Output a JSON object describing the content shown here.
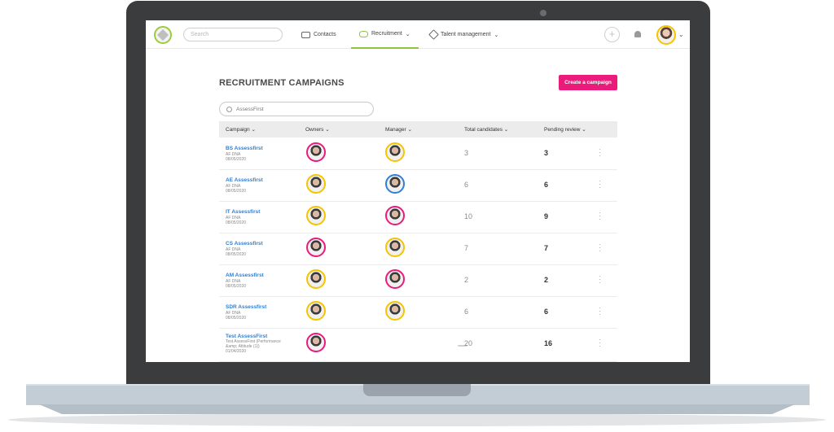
{
  "topbar": {
    "search_placeholder": "Search",
    "nav": [
      {
        "label": "Contacts",
        "icon": "contacts-icon",
        "active": false
      },
      {
        "label": "Recruitment",
        "icon": "recruitment-icon",
        "active": true
      },
      {
        "label": "Talent management",
        "icon": "diamond-icon",
        "active": false
      }
    ],
    "accent_color": "#8cc63f"
  },
  "page": {
    "title": "RECRUITMENT CAMPAIGNS",
    "create_button": "Create a campaign",
    "filter_value": "AssessFirst",
    "brand_color": "#ea1b7b"
  },
  "table": {
    "headers": [
      "Campaign",
      "Owners",
      "Manager",
      "Total candidates",
      "Pending review"
    ],
    "rows": [
      {
        "name": "BS Assessfirst",
        "sub": "AF DNA",
        "date": "08/05/2020",
        "total": "3",
        "pending": "3"
      },
      {
        "name": "AE Assessfirst",
        "sub": "AF DNA",
        "date": "08/05/2020",
        "total": "6",
        "pending": "6"
      },
      {
        "name": "IT Assessfirst",
        "sub": "AF DNA",
        "date": "08/05/2020",
        "total": "10",
        "pending": "9"
      },
      {
        "name": "CS Assessfirst",
        "sub": "AF DNA",
        "date": "08/05/2020",
        "total": "7",
        "pending": "7"
      },
      {
        "name": "AM Assessfirst",
        "sub": "AF DNA",
        "date": "08/05/2020",
        "total": "2",
        "pending": "2"
      },
      {
        "name": "SDR Assessfirst",
        "sub": "AF DNA",
        "date": "08/05/2020",
        "total": "6",
        "pending": "6"
      },
      {
        "name": "Test AssessFirst",
        "sub": "Test AssessFirst (Performance &amp; Attitude (1))",
        "date": "01/04/2020",
        "total": "20",
        "pending": "16"
      }
    ]
  }
}
